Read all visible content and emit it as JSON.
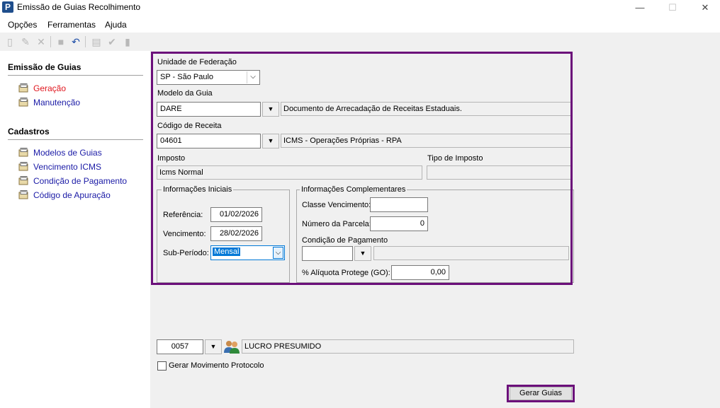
{
  "window": {
    "title": "Emissão de Guias Recolhimento",
    "minimize": "—",
    "maximize": "☐",
    "close": "✕"
  },
  "menu": [
    "Opções",
    "Ferramentas",
    "Ajuda"
  ],
  "sidebar": {
    "section1": "Emissão de Guias",
    "items1": [
      "Geração",
      "Manutenção"
    ],
    "section2": "Cadastros",
    "items2": [
      "Modelos de Guias",
      "Vencimento ICMS",
      "Condição de Pagamento",
      "Código de Apuração"
    ]
  },
  "form": {
    "uf_label": "Unidade de Federação",
    "uf_value": "SP - São Paulo",
    "modelo_label": "Modelo da Guia",
    "modelo_code": "DARE",
    "modelo_desc": "Documento de Arrecadação de Receitas Estaduais.",
    "receita_label": "Código de Receita",
    "receita_code": "04601",
    "receita_desc": "ICMS - Operações Próprias - RPA",
    "imposto_label": "Imposto",
    "imposto_value": "Icms Normal",
    "tipo_imposto_label": "Tipo de Imposto",
    "tipo_imposto_value": ""
  },
  "info_iniciais": {
    "title": "Informações Iniciais",
    "referencia_label": "Referência:",
    "referencia_value": "01/02/2026",
    "vencimento_label": "Vencimento:",
    "vencimento_value": "28/02/2026",
    "subperiodo_label": "Sub-Período:",
    "subperiodo_value": "Mensal"
  },
  "info_complementares": {
    "title": "Informações Complementares",
    "classe_label": "Classe Vencimento:",
    "classe_value": "",
    "parcela_label": "Número da Parcela:",
    "parcela_value": "0",
    "condicao_label": "Condição de Pagamento",
    "condicao_code": "",
    "condicao_desc": "",
    "aliquota_label": "% Alíquota Protege (GO):",
    "aliquota_value": "0,00"
  },
  "company": {
    "code": "0057",
    "name": "LUCRO PRESUMIDO"
  },
  "protocolo_label": "Gerar Movimento Protocolo",
  "gerar_label": "Gerar Guias",
  "colors": {
    "highlight": "#6b0f7a",
    "link": "#1a1aa6",
    "active_link": "#e0161e"
  }
}
